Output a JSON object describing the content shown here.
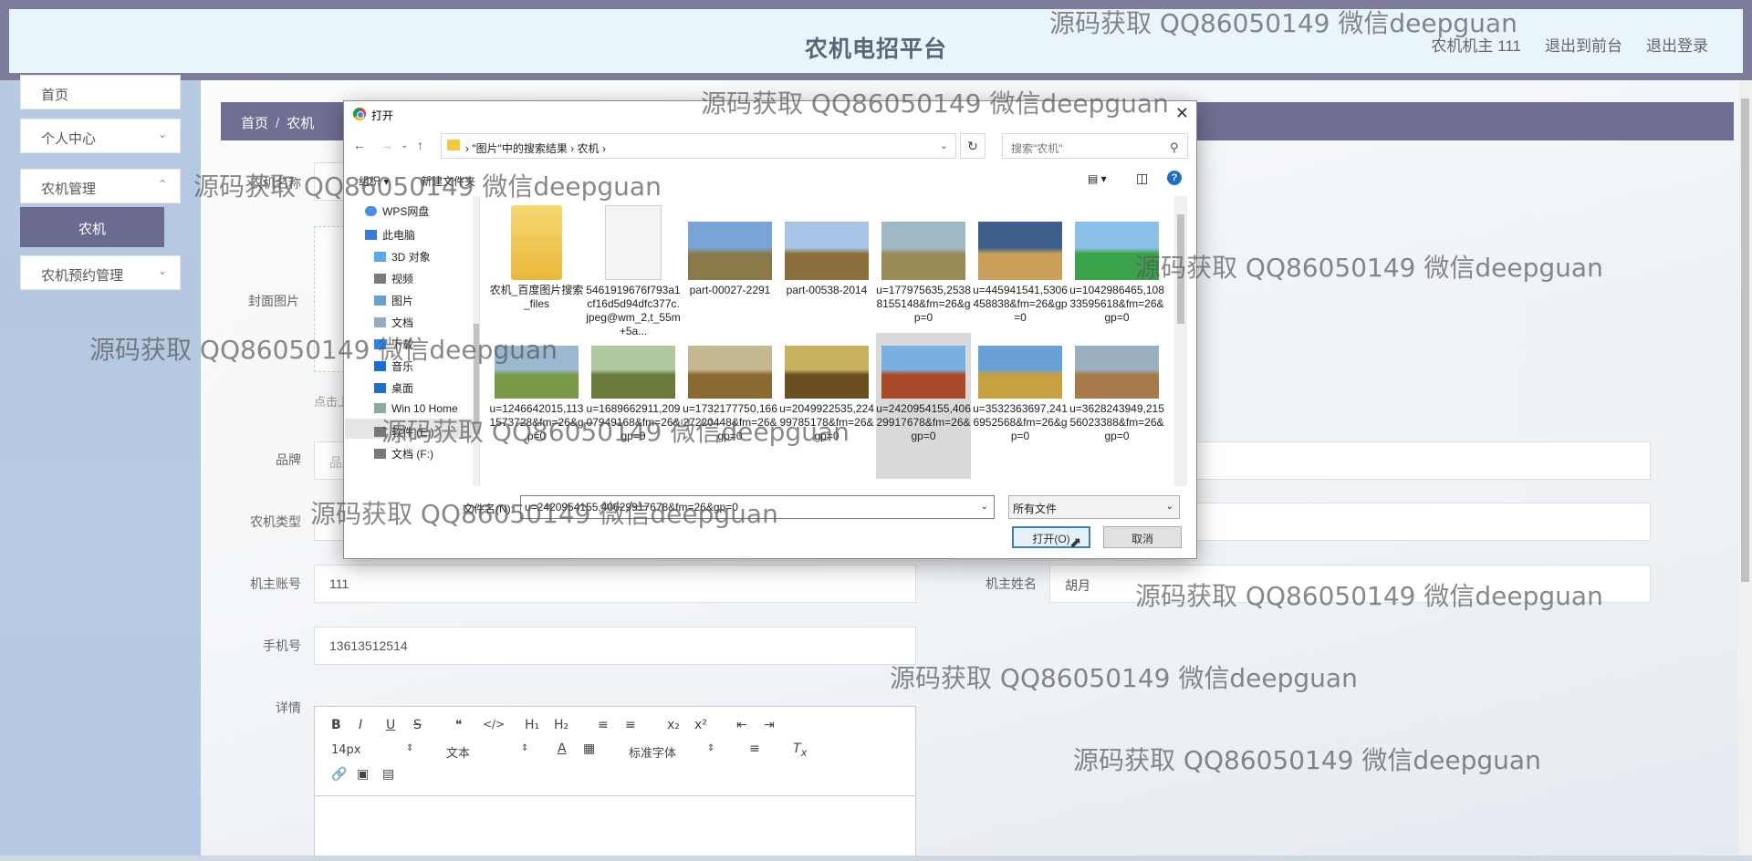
{
  "header": {
    "title": "农机电招平台",
    "user": "农机机主 111",
    "to_front": "退出到前台",
    "logout": "退出登录"
  },
  "sidebar": {
    "items": [
      {
        "label": "首页"
      },
      {
        "label": "个人中心"
      },
      {
        "label": "农机管理"
      },
      {
        "label": "农机预约管理"
      }
    ],
    "active_sub": "农机"
  },
  "breadcrumb": {
    "home": "首页",
    "sep": "/",
    "current": "农机"
  },
  "form": {
    "name_label": "农机名称",
    "cover_label": "封面图片",
    "upload_tip": "点击上传封面图片",
    "brand_label": "品牌",
    "brand_placeholder": "品牌",
    "type_label": "农机类型",
    "owner_account_label": "机主账号",
    "owner_account_value": "111",
    "owner_name_label": "机主姓名",
    "owner_name_value": "胡月",
    "phone_label": "手机号",
    "phone_value": "13613512514",
    "details_label": "详情"
  },
  "editor": {
    "font_size": "14px",
    "para": "文本",
    "font_family": "标准字体"
  },
  "dialog": {
    "title": "打开",
    "path": [
      "\"图片\"中的搜索结果",
      "农机"
    ],
    "search_placeholder": "搜索\"农机\"",
    "organize": "组织 ▾",
    "new_folder": "新建文件夹",
    "nav": [
      "WPS网盘",
      "此电脑",
      "3D 对象",
      "视频",
      "图片",
      "文档",
      "下载",
      "音乐",
      "桌面",
      "Win 10 Home",
      "软件 (E:)",
      "文档 (F:)"
    ],
    "files": [
      {
        "name": "农机_百度图片搜索_files",
        "kind": "folder"
      },
      {
        "name": "5461919676f793a1cf16d5d94dfc377c.jpeg@wm_2,t_55m+5a...",
        "kind": "doc"
      },
      {
        "name": "part-00027-2291",
        "kind": "img"
      },
      {
        "name": "part-00538-2014",
        "kind": "img"
      },
      {
        "name": "u=177975635,25388155148&fm=26&gp=0",
        "kind": "img"
      },
      {
        "name": "u=445941541,5306458838&fm=26&gp=0",
        "kind": "img"
      },
      {
        "name": "u=1042986465,10833595618&fm=26&gp=0",
        "kind": "img"
      },
      {
        "name": "u=1246642015,1131573728&fm=26&gp=0",
        "kind": "img"
      },
      {
        "name": "u=1689662911,20907949168&fm=26&gp=0",
        "kind": "img"
      },
      {
        "name": "u=1732177750,16627220448&fm=26&gp=0",
        "kind": "img"
      },
      {
        "name": "u=2049922535,22499785178&fm=26&gp=0",
        "kind": "img"
      },
      {
        "name": "u=2420954155,40629917678&fm=26&gp=0",
        "kind": "img",
        "selected": true
      },
      {
        "name": "u=3532363697,2416952568&fm=26&gp=0",
        "kind": "img"
      },
      {
        "name": "u=3628243949,21556023388&fm=26&gp=0",
        "kind": "img"
      }
    ],
    "filename_label": "文件名(N):",
    "filename_value": "u=2420954155,40629917678&fm=26&gp=0",
    "filetype": "所有文件",
    "open": "打开(O)",
    "cancel": "取消"
  },
  "watermark": "源码获取 QQ86050149 微信deepguan"
}
